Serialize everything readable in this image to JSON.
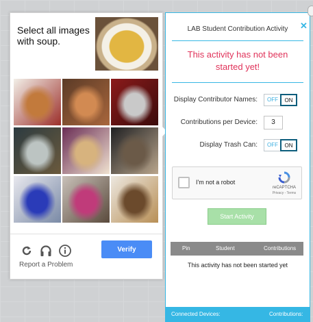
{
  "captcha": {
    "prompt": "Select all images with soup.",
    "verify_label": "Verify",
    "report_label": "Report a Problem",
    "icons": [
      "reload-icon",
      "audio-icon",
      "info-icon"
    ],
    "tiles": [
      {
        "name": "sandwich",
        "colors": [
          "#f2efe8",
          "#c27a3c",
          "#9c2f2a"
        ]
      },
      {
        "name": "noodle-soup",
        "colors": [
          "#5b3b27",
          "#d28a52",
          "#a8663c"
        ]
      },
      {
        "name": "microphone",
        "colors": [
          "#8b1b1b",
          "#c9c9c9",
          "#3b0b0b"
        ]
      },
      {
        "name": "buffet-tray",
        "colors": [
          "#2c3b40",
          "#bcc4c2",
          "#6b5a3d"
        ]
      },
      {
        "name": "bowl-soup-purple",
        "colors": [
          "#6a2d55",
          "#d7b37e",
          "#f0e2d0"
        ]
      },
      {
        "name": "mussels",
        "colors": [
          "#1f2022",
          "#6b5a48",
          "#b9a58c"
        ]
      },
      {
        "name": "blue-glass",
        "colors": [
          "#e8e8ee",
          "#2a3bb8",
          "#7a8aa6"
        ]
      },
      {
        "name": "flowers-table",
        "colors": [
          "#c9c1b9",
          "#c03b7a",
          "#5a4a3c"
        ]
      },
      {
        "name": "plated-dish",
        "colors": [
          "#ece7df",
          "#6b4a2c",
          "#b88f56"
        ]
      }
    ]
  },
  "panel": {
    "title": "LAB Student Contribution Activity",
    "alert": "This activity has not been started yet!",
    "settings": [
      {
        "label": "Display Contributor Names:",
        "off": "OFF",
        "on": "ON"
      },
      {
        "label": "Contributions per Device:",
        "value": "3"
      },
      {
        "label": "Display Trash Can:",
        "off": "OFF",
        "on": "ON"
      }
    ],
    "recaptcha": {
      "label": "I'm not a robot",
      "brand": "reCAPTCHA",
      "links": "Privacy - Terms"
    },
    "start_label": "Start Activity",
    "table_headers": [
      "Pin",
      "Student",
      "Contributions"
    ],
    "empty_message": "This activity has not been started yet",
    "footer_left": "Connected Devices:",
    "footer_right": "Contributions:"
  },
  "colors": {
    "accent": "#35b7e4",
    "alert": "#e0335a",
    "verify": "#4a8cf6",
    "start": "#a8e0a8"
  }
}
